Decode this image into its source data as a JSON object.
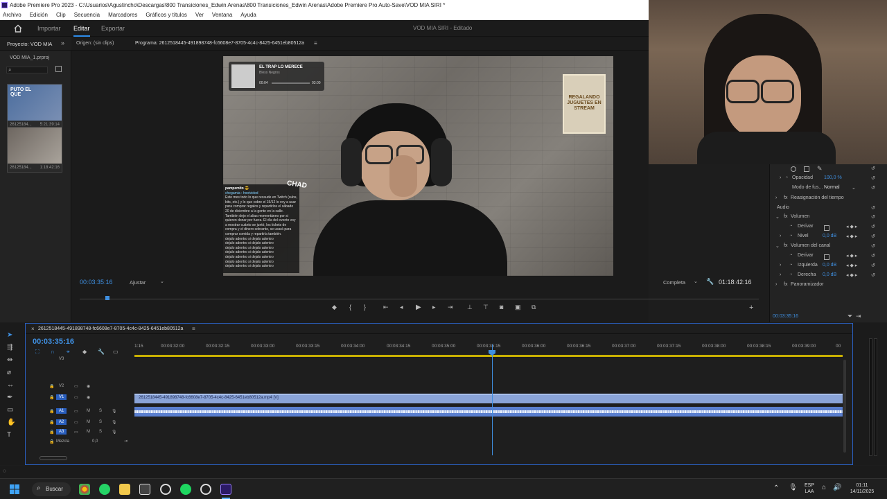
{
  "window": {
    "title": "Adobe Premiere Pro 2023 - C:\\Usuarios\\Agustincho\\Descargas\\800 Transiciones_Edwin Arenas\\800 Transiciones_Edwin Arenas\\Adobe Premiere Pro Auto-Save\\VOD MIA SIRI *"
  },
  "menu": [
    "Archivo",
    "Edición",
    "Clip",
    "Secuencia",
    "Marcadores",
    "Gráficos y títulos",
    "Ver",
    "Ventana",
    "Ayuda"
  ],
  "workspace": {
    "tabs": [
      "Importar",
      "Editar",
      "Exportar"
    ],
    "active": "Editar",
    "project_title": "VOD MIA SIRI",
    "status": "Editado"
  },
  "project_panel": {
    "tab": "Proyecto: VOD MIA",
    "file": "VOD MIA_1.prproj",
    "items": [
      {
        "name": "26125184...",
        "duration": "5:21:39:14",
        "caption": "PUTO EL QUE"
      },
      {
        "name": "26125184...",
        "duration": "1:18:42:16"
      }
    ]
  },
  "source_tab": "Origen: (sin clips)",
  "program_tab": "Programa: 2612518445-491898748-fc6608e7-8705-4c4c-8425-6451eb80512a",
  "overlay": {
    "music_title": "EL TRAP LO MERECE",
    "music_artist": "Bless Negros",
    "music_elapsed": "00:04",
    "music_total": "03:00",
    "giveaway": "REGALANDO JUGUETES EN STREAM",
    "chad": "CHAD",
    "chat_lines": [
      "pampemito 😎",
      "chegamia : hootvided",
      "Este mes todo lo que recaude en Twitch (subs, bits, etc.) y lo que cobre el 15/12 lo voy a usar para comprar regalos y repartirlos el sábado 20 de diciembre a la gente en la calle. También dejo el alias momentáneo por si quieren donar por fuera. El día del evento voy a mostrar cuánto se juntó, los tickets de compra y el dinero sobrante, se usará para comprar comida y repartirla también.",
      "dejalo adentro si dejalo adentro",
      "dejalo adentro si dejalo adentro",
      "dejalo adentro si dejalo adentro",
      "dejalo adentro si dejalo adentro",
      "dejalo adentro si dejalo adentro",
      "dejalo adentro si dejalo adentro",
      "dejalo adentro si dejalo adentro"
    ]
  },
  "program_monitor": {
    "timecode": "00:03:35:16",
    "fit": "Ajustar",
    "quality": "Completa",
    "duration": "01:18:42:16"
  },
  "effects": {
    "opacity_label": "Opacidad",
    "opacity_value": "100,0 %",
    "blend_label": "Modo de fus...",
    "blend_value": "Normal",
    "time_remap": "Reasignación del tiempo",
    "audio_label": "Audio",
    "volume": "Volumen",
    "bypass": "Derivar",
    "level_label": "Nivel",
    "level_value": "0,0 dB",
    "channel_volume": "Volumen del canal",
    "left_label": "Izquierda",
    "left_value": "0,0 dB",
    "right_label": "Derecha",
    "right_value": "0,0 dB",
    "panner": "Panoramizador",
    "timecode": "00:03:35:16"
  },
  "timeline": {
    "sequence": "2612518445-491898748-fc6608e7-8705-4c4c-8425-6451eb80512a",
    "timecode": "00:03:35:16",
    "ticks": [
      "1:15",
      "00:03:32:00",
      "00:03:32:15",
      "00:03:33:00",
      "00:03:33:15",
      "00:03:34:00",
      "00:03:34:15",
      "00:03:35:00",
      "00:03:35:15",
      "00:03:36:00",
      "00:03:36:15",
      "00:03:37:00",
      "00:03:37:15",
      "00:03:38:00",
      "00:03:38:15",
      "00:03:39:00",
      "00"
    ],
    "tracks": [
      "V3",
      "V2",
      "V1",
      "A1",
      "A2",
      "A3"
    ],
    "mix_label": "Mezcla",
    "mix_value": "0,0",
    "video_clip": "2612518445-491898748-fc6608e7-8705-4c4c-8425-6451eb80512a.mp4 [V]"
  },
  "taskbar": {
    "search": "Buscar",
    "lang1": "ESP",
    "lang2": "LAA",
    "time": "01:11",
    "date": "14/11/2025"
  }
}
